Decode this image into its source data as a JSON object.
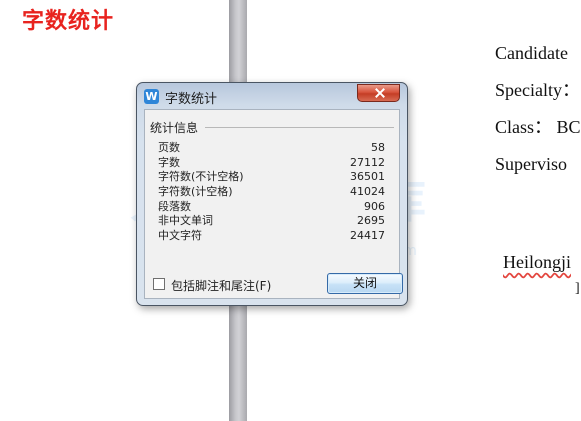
{
  "page": {
    "title": "字数统计",
    "document_lines": [
      "Candidate",
      "Specialty：",
      "Class： BC",
      "Superviso"
    ],
    "document_extra": "Heilongji",
    "document_extra_2": "]"
  },
  "dialog": {
    "title": "字数统计",
    "group_label": "统计信息",
    "stats": [
      {
        "label": "页数",
        "value": "58"
      },
      {
        "label": "字数",
        "value": "27112"
      },
      {
        "label": "字符数(不计空格)",
        "value": "36501"
      },
      {
        "label": "字符数(计空格)",
        "value": "41024"
      },
      {
        "label": "段落数",
        "value": "906"
      },
      {
        "label": "非中文单词",
        "value": "2695"
      },
      {
        "label": "中文字符",
        "value": "24417"
      }
    ],
    "checkbox_label": "包括脚注和尾注(F)",
    "close_button_label": "关闭"
  },
  "watermark": {
    "left_text": "人人",
    "center_text": "文",
    "right_text": "库",
    "url_text": "ncndoc.com"
  },
  "colors": {
    "title_red": "#e8231f",
    "dialog_blue": "#d7e2ee",
    "button_blue": "#c7e2f7",
    "close_red": "#d8543d"
  }
}
